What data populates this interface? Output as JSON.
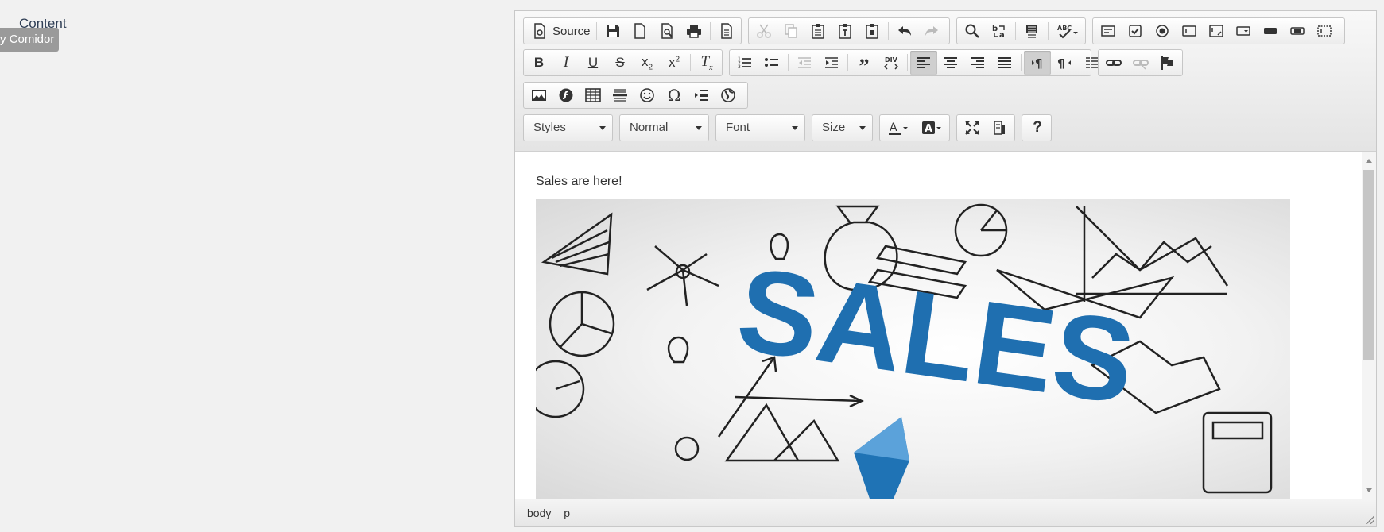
{
  "page": {
    "label": "Content"
  },
  "tooltip": {
    "text": "y Comidor"
  },
  "toolbar": {
    "source_label": "Source",
    "combos": {
      "styles": "Styles",
      "format": "Normal",
      "font": "Font",
      "size": "Size"
    }
  },
  "editor": {
    "text": "Sales are here!",
    "image_text": "SALES"
  },
  "statusbar": {
    "path": [
      "body",
      "p"
    ]
  }
}
